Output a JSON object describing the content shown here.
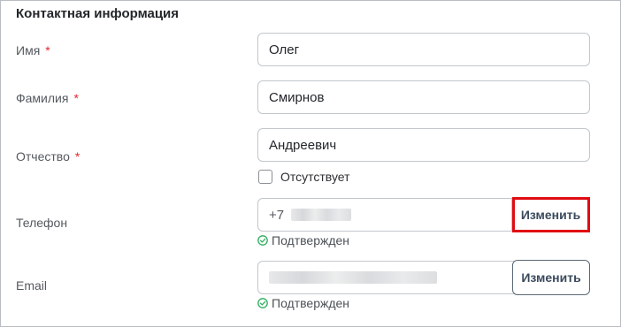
{
  "section": {
    "title": "Контактная информация"
  },
  "fields": {
    "first_name": {
      "label": "Имя",
      "required_mark": "*",
      "value": "Олег"
    },
    "last_name": {
      "label": "Фамилия",
      "required_mark": "*",
      "value": "Смирнов"
    },
    "patronymic": {
      "label": "Отчество",
      "required_mark": "*",
      "value": "Андреевич",
      "absent_label": "Отсутствует",
      "absent_checked": false
    },
    "phone": {
      "label": "Телефон",
      "prefix": "+7",
      "change_label": "Изменить",
      "status": "Подтвержден"
    },
    "email": {
      "label": "Email",
      "change_label": "Изменить",
      "status": "Подтвержден"
    }
  },
  "icons": {
    "confirmed": "check-circle-icon"
  },
  "colors": {
    "required": "#e0282e",
    "confirmed": "#2fae5e",
    "highlight": "#e00c12"
  }
}
